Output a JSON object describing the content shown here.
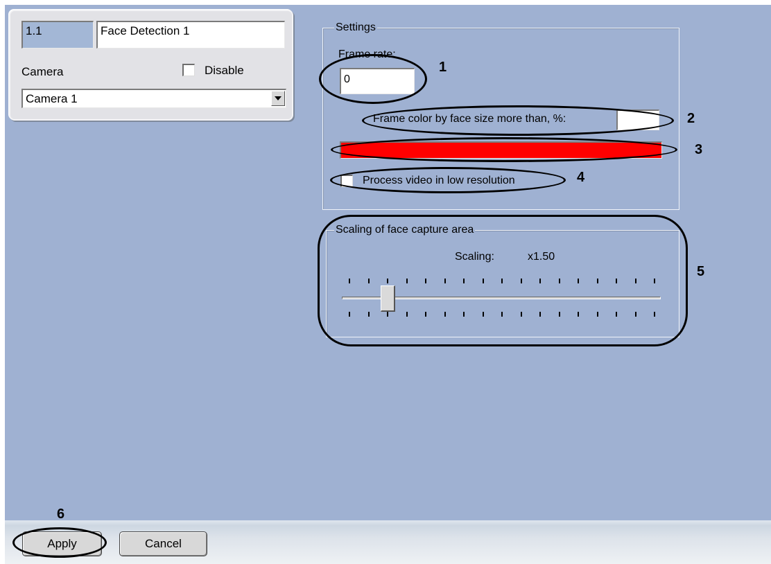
{
  "object": {
    "id": "1.1",
    "name": "Face Detection 1",
    "camera_label": "Camera",
    "disable_label": "Disable",
    "camera_selected": "Camera 1"
  },
  "settings": {
    "title": "Settings",
    "frame_rate_label": "Frame rate:",
    "frame_rate_value": "0",
    "frame_color_label": "Frame color by face size more than, %:",
    "frame_color_value": "",
    "frame_color": "#ff0000",
    "process_low_res_label": "Process video in low resolution"
  },
  "scaling": {
    "title": "Scaling of face capture area",
    "label": "Scaling:",
    "value": "x1.50"
  },
  "buttons": {
    "apply": "Apply",
    "cancel": "Cancel"
  },
  "callouts": [
    "1",
    "2",
    "3",
    "4",
    "5",
    "6"
  ]
}
